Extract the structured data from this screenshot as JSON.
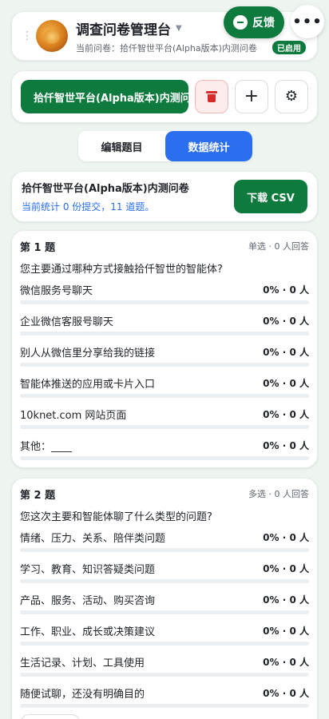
{
  "header": {
    "title": "调查问卷管理台",
    "subtitle": "当前问卷：拾仟智世平台(Alpha版本)内测问卷",
    "badge": "已启用"
  },
  "floating": {
    "feedback_label": "反馈",
    "more_label": "•••"
  },
  "toolbar": {
    "survey_button_label": "拾仟智世平台(Alpha版本)内测问卷",
    "add_symbol": "+",
    "settings_symbol": "⚙"
  },
  "tabs": [
    {
      "label": "编辑题目",
      "active": false
    },
    {
      "label": "数据统计",
      "active": true
    }
  ],
  "summary": {
    "title": "拾仟智世平台(Alpha版本)内测问卷",
    "stats_text": "当前统计 0 份提交，11 道题。",
    "download_label": "下载 CSV"
  },
  "questions": [
    {
      "number": "第 1 题",
      "meta": "单选 · 0 人回答",
      "text": "您主要通过哪种方式接触拾仟智世的智能体?",
      "options": [
        {
          "label": "微信服务号聊天",
          "stat": "0% · 0 人",
          "fraction": 0
        },
        {
          "label": "企业微信客服号聊天",
          "stat": "0% · 0 人",
          "fraction": 0
        },
        {
          "label": "别人从微信里分享给我的链接",
          "stat": "0% · 0 人",
          "fraction": 0
        },
        {
          "label": "智能体推送的应用或卡片入口",
          "stat": "0% · 0 人",
          "fraction": 0
        },
        {
          "label": "10knet.com 网站页面",
          "stat": "0% · 0 人",
          "fraction": 0
        },
        {
          "label": "其他：____",
          "stat": "0% · 0 人",
          "fraction": 0
        }
      ]
    },
    {
      "number": "第 2 题",
      "meta": "多选 · 0 人回答",
      "text": "您这次主要和智能体聊了什么类型的问题?",
      "options": [
        {
          "label": "情绪、压力、关系、陪伴类问题",
          "stat": "0% · 0 人",
          "fraction": 0
        },
        {
          "label": "学习、教育、知识答疑类问题",
          "stat": "0% · 0 人",
          "fraction": 0
        },
        {
          "label": "产品、服务、活动、购买咨询",
          "stat": "0% · 0 人",
          "fraction": 0
        },
        {
          "label": "工作、职业、成长或决策建议",
          "stat": "0% · 0 人",
          "fraction": 0
        },
        {
          "label": "生活记录、计划、工具使用",
          "stat": "0% · 0 人",
          "fraction": 0
        },
        {
          "label": "随便试聊，还没有明确目的",
          "stat": "0% · 0 人",
          "fraction": 0
        }
      ]
    }
  ],
  "colors": {
    "primary_green": "#0f7a3d",
    "active_blue": "#2b6ff0",
    "danger_red": "#d62b2b",
    "background": "#eef4f0"
  },
  "icons": [
    "drag-handle-icon",
    "avatar",
    "chat-icon",
    "trash-icon",
    "plus-icon",
    "gear-icon"
  ]
}
